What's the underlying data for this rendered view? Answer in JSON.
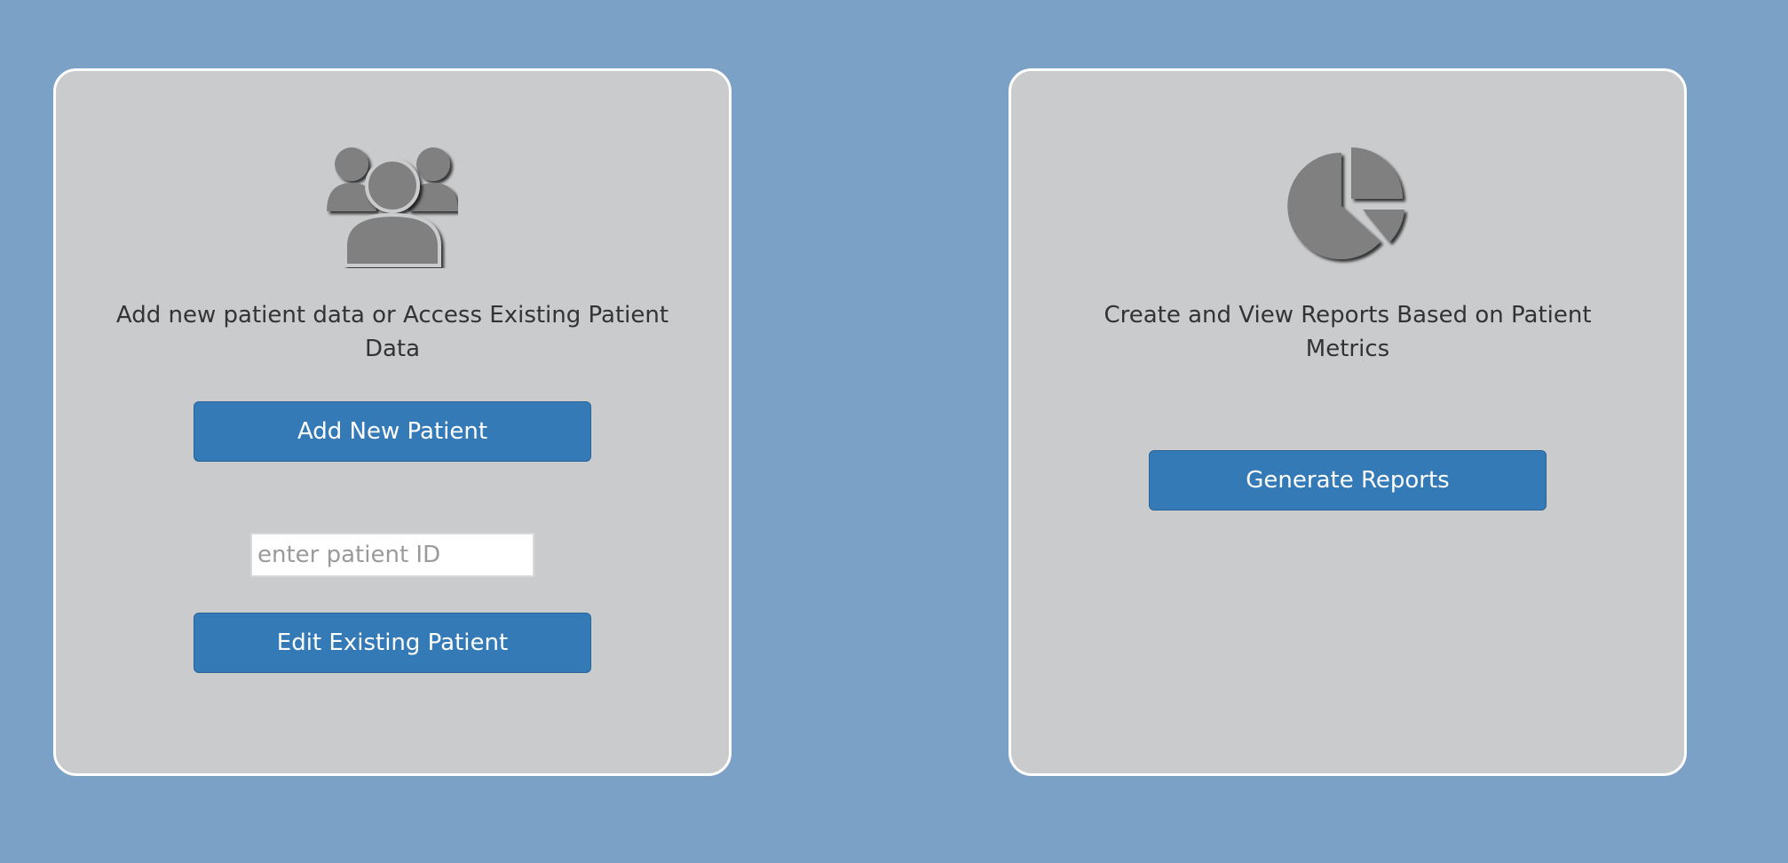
{
  "patients_panel": {
    "icon": "users-icon",
    "description": "Add new patient data or Access Existing Patient Data",
    "add_button_label": "Add New Patient",
    "patient_id_placeholder": "enter patient ID",
    "patient_id_value": "",
    "edit_button_label": "Edit Existing Patient"
  },
  "reports_panel": {
    "icon": "pie-chart-icon",
    "description": "Create and View Reports Based on Patient Metrics",
    "generate_button_label": "Generate Reports"
  },
  "colors": {
    "background": "#7ba1c7",
    "panel": "#cacbcd",
    "panel_border": "#ffffff",
    "button": "#337ab7",
    "icon": "#808080"
  }
}
